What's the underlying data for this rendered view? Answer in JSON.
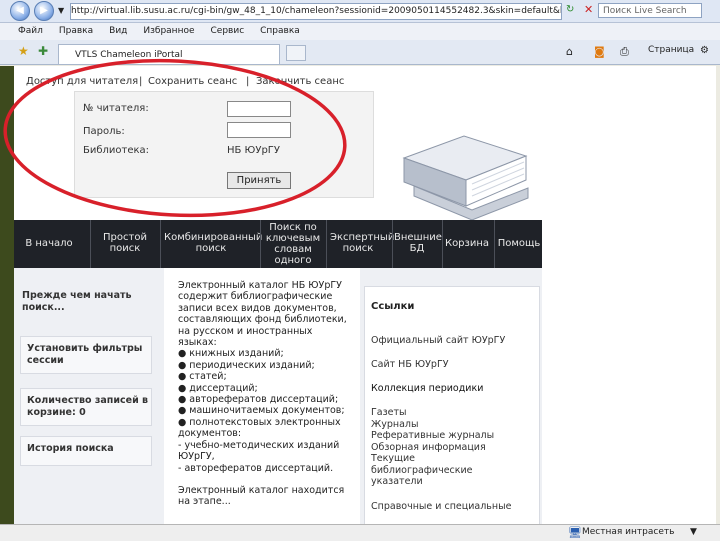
{
  "browser": {
    "url": "http://virtual.lib.susu.ac.ru/cgi-bin/gw_48_1_10/chameleon?sessionid=2009050114552482.3&skin=default&lng=ru&inst=co",
    "search_placeholder": "Поиск Live Search",
    "menu": [
      "Файл",
      "Правка",
      "Вид",
      "Избранное",
      "Сервис",
      "Справка"
    ],
    "tab_title": "VTLS Chameleon iPortal",
    "toolbar_page": "Страница"
  },
  "login": {
    "links": [
      "Доступ для читателя",
      "Сохранить сеанс",
      "Закончить сеанс"
    ],
    "reader_label": "№ читателя:",
    "password_label": "Пароль:",
    "library_label": "Библиотека:",
    "library_value": "НБ ЮУрГУ",
    "submit_label": "Принять"
  },
  "nav": {
    "items": [
      "В начало",
      "Простой поиск",
      "Комбинированный поиск",
      "Поиск по ключевым словам одного поля",
      "Экспертный поиск",
      "Внешние БД",
      "Корзина",
      "Помощь"
    ]
  },
  "left": {
    "intro": "Прежде чем начать поиск...",
    "boxes": [
      "Установить фильтры сессии",
      "Количество записей в корзине: 0",
      "История поиска"
    ]
  },
  "middle": {
    "lines": [
      "Электронный каталог НБ ЮУрГУ",
      "содержит библиографические",
      "записи всех видов документов,",
      "составляющих фонд библиотеки,",
      "на русском и иностранных",
      "языках:",
      "● книжных изданий;",
      "● периодических изданий;",
      "● статей;",
      "● диссертаций;",
      "● авторефератов диссертаций;",
      "● машиночитаемых документов;",
      "● полнотекстовых электронных",
      "  документов:",
      "  - учебно-методических изданий",
      "  ЮУрГУ,",
      "  - авторефератов диссертаций.",
      "",
      "Электронный каталог находится",
      "на этапе..."
    ]
  },
  "right": {
    "heading": "Ссылки",
    "links": [
      "Официальный сайт ЮУрГУ",
      "Сайт НБ ЮУрГУ"
    ],
    "section": "Коллекция периодики",
    "sublinks": [
      "Газеты",
      "Журналы",
      "Реферативные журналы",
      "Обзорная информация",
      "Текущие",
      "библиографические",
      "указатели"
    ],
    "last": "Справочные и специальные"
  },
  "status": {
    "zone": "Местная интрасеть"
  },
  "colors": {
    "nav_bg": "#1f2228",
    "annotation": "#d8202a"
  }
}
